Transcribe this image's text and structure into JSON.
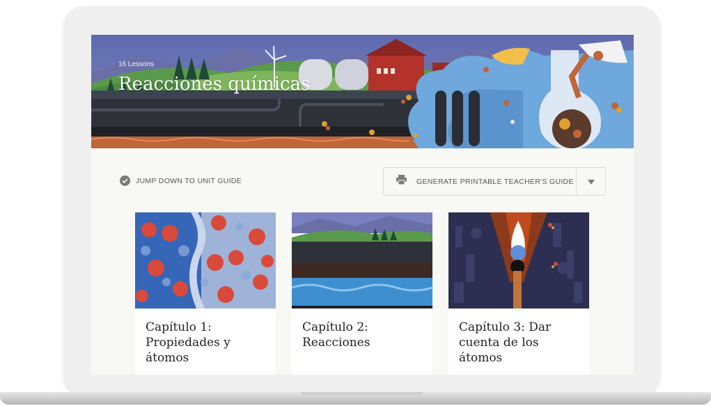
{
  "unit": {
    "lessons_label": "16 Lessons",
    "title": "Reacciones químicas"
  },
  "actions": {
    "jump_label": "JUMP DOWN TO UNIT GUIDE",
    "generate_label": "GENERATE PRINTABLE TEACHER'S GUIDE"
  },
  "chapters": [
    {
      "title": "Capítulo 1: Propiedades y átomos"
    },
    {
      "title": "Capítulo 2: Reacciones"
    },
    {
      "title": "Capítulo 3: Dar cuenta de los átomos"
    }
  ],
  "colors": {
    "sky": "#6d78b8",
    "hill_green": "#5a9a4c",
    "barn_red": "#b3322a",
    "bubble_blue": "#6ea8dc",
    "ground_dark": "#2e3138",
    "page_bg": "#f8f8f5",
    "laptop_frame": "#efefef"
  },
  "icons": [
    "check-circle-icon",
    "printer-icon",
    "caret-down-icon"
  ]
}
